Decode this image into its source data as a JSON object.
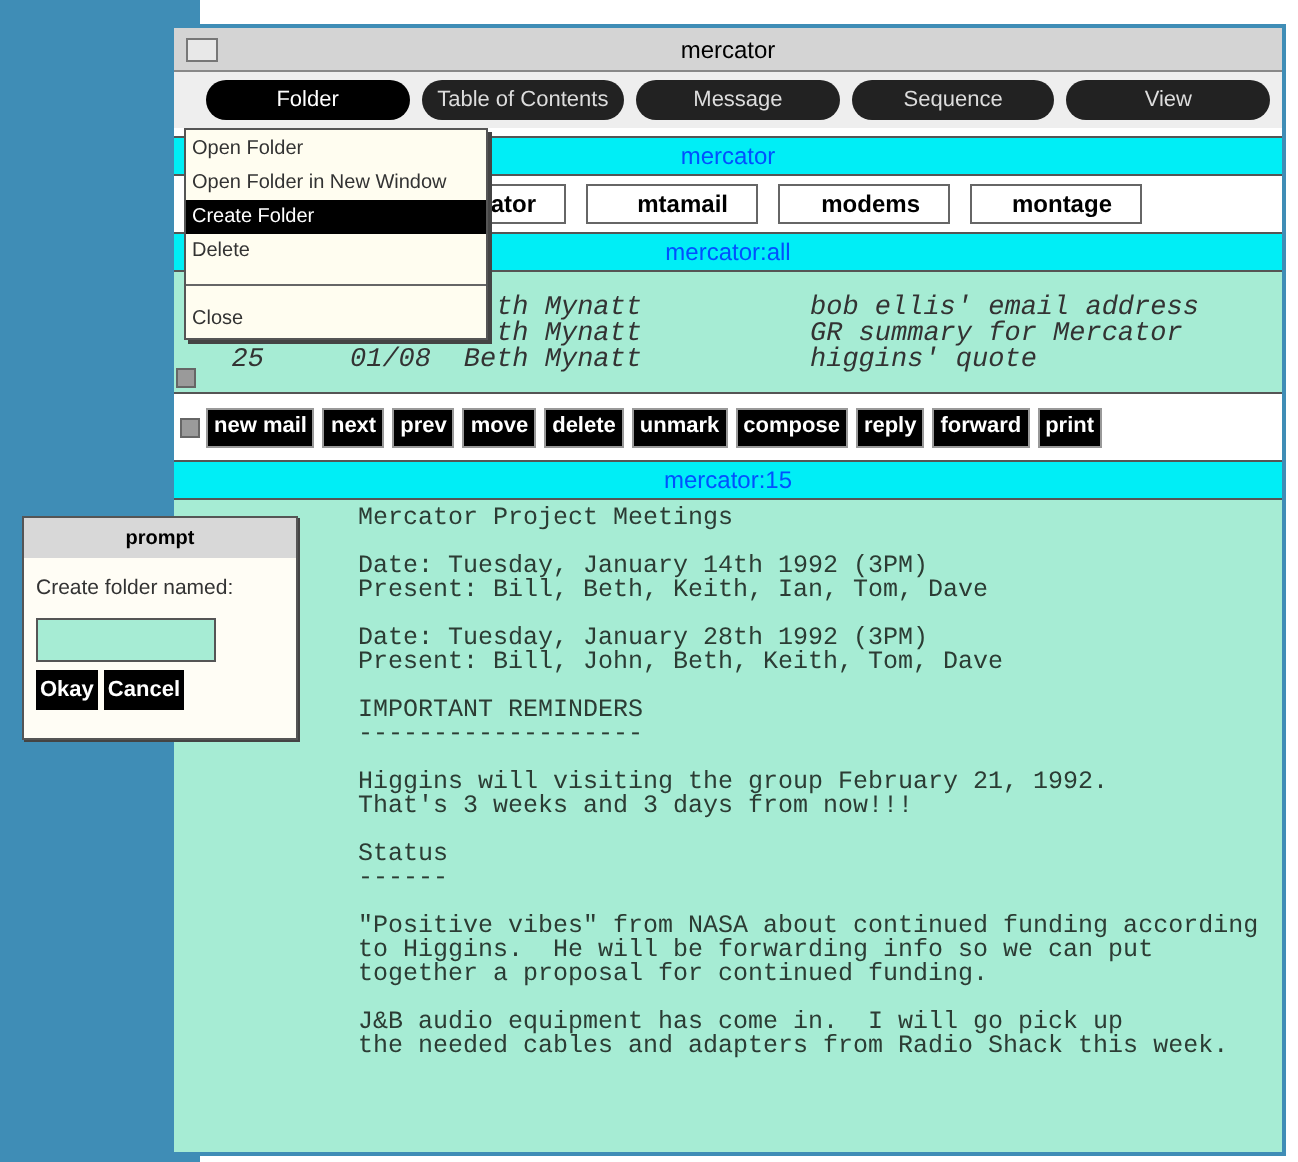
{
  "window": {
    "title": "mercator"
  },
  "menubar": [
    {
      "label": "Folder",
      "selected": true
    },
    {
      "label": "Table of Contents",
      "selected": false
    },
    {
      "label": "Message",
      "selected": false
    },
    {
      "label": "Sequence",
      "selected": false
    },
    {
      "label": "View",
      "selected": false
    }
  ],
  "folder_menu": {
    "items": [
      {
        "kind": "item",
        "label": "Open Folder",
        "selected": false
      },
      {
        "kind": "item",
        "label": "Open Folder in New Window",
        "selected": false
      },
      {
        "kind": "item",
        "label": "Create Folder",
        "selected": true
      },
      {
        "kind": "item",
        "label": "Delete",
        "selected": false
      },
      {
        "kind": "separator"
      },
      {
        "kind": "item",
        "label": "Close",
        "selected": false
      }
    ]
  },
  "folder_pane": {
    "title": "mercator",
    "folders": [
      {
        "label": "ator"
      },
      {
        "label": "mtamail"
      },
      {
        "label": "modems"
      },
      {
        "label": "montage"
      }
    ]
  },
  "toc_pane": {
    "title": "mercator:all",
    "rows": [
      {
        "sender": "th Mynatt",
        "subject": "bob ellis' email address"
      },
      {
        "sender": "th Mynatt",
        "subject": "GR summary for Mercator"
      },
      {
        "number": "25",
        "date": "01/08",
        "sender": "Beth Mynatt",
        "subject": "higgins' quote"
      }
    ]
  },
  "toolbar": [
    "new mail",
    "next",
    "prev",
    "move",
    "delete",
    "unmark",
    "compose",
    "reply",
    "forward",
    "print"
  ],
  "message_pane": {
    "title": "mercator:15",
    "blocks": [
      [
        "Mercator Project Meetings"
      ],
      [
        "Date: Tuesday, January 14th 1992 (3PM)",
        "Present: Bill, Beth, Keith, Ian, Tom, Dave"
      ],
      [
        "Date: Tuesday, January 28th 1992 (3PM)",
        "Present: Bill, John, Beth, Keith, Tom, Dave"
      ],
      [
        "IMPORTANT REMINDERS",
        "-------------------"
      ],
      [
        "Higgins will visiting the group February 21, 1992.",
        "That's 3 weeks and 3 days from now!!!"
      ],
      [
        "Status",
        "------"
      ],
      [
        "\"Positive vibes\" from NASA about continued funding according",
        "to Higgins.  He will be forwarding info so we can put",
        "together a proposal for continued funding."
      ],
      [
        "J&B audio equipment has come in.  I will go pick up",
        "the needed cables and adapters from Radio Shack this week."
      ]
    ]
  },
  "prompt": {
    "title": "prompt",
    "label": "Create folder named:",
    "buttons": [
      "Okay",
      "Cancel"
    ]
  }
}
